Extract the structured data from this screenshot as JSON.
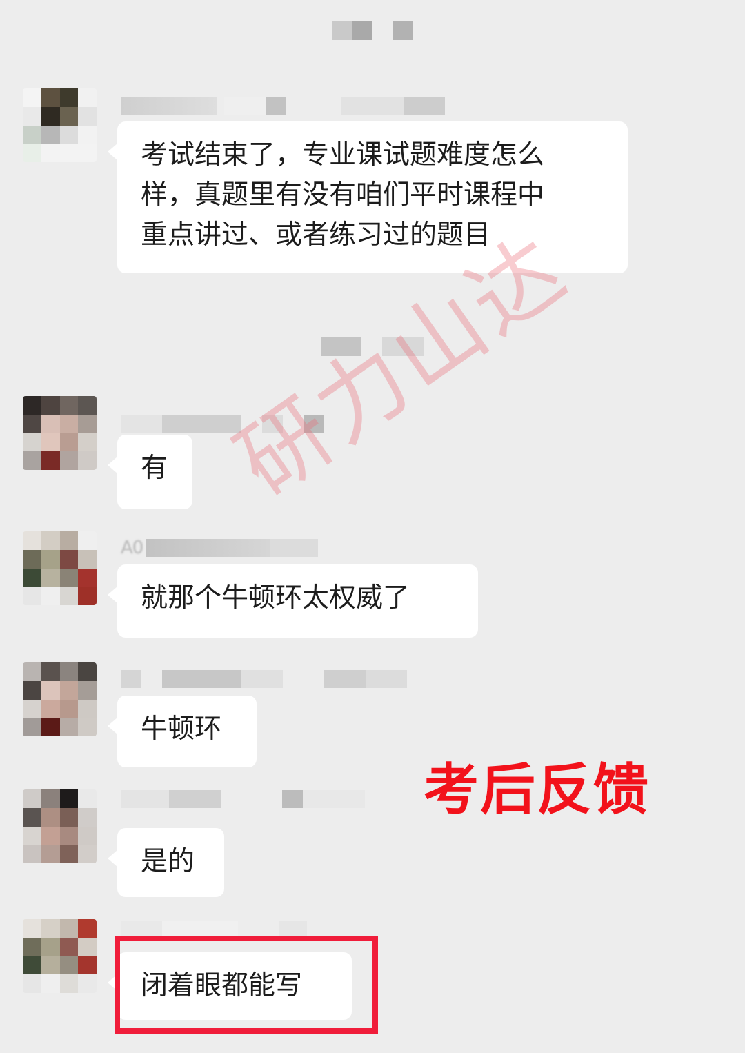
{
  "messages": [
    {
      "sender_visible": "",
      "text": "考试结束了，专业课试题难度怎么\n样，真题里有没有咱们平时课程中\n重点讲过、或者练习过的题目"
    },
    {
      "sender_visible": "",
      "text": "有"
    },
    {
      "sender_visible": "A0",
      "text": "就那个牛顿环太权威了"
    },
    {
      "sender_visible": "",
      "text": "牛顿环"
    },
    {
      "sender_visible": "",
      "text": "是的"
    },
    {
      "sender_visible": "",
      "text": "闭着眼都能写"
    }
  ],
  "watermark": "研力山达",
  "overlay_label": "考后反馈",
  "colors": {
    "background": "#ededed",
    "bubble": "#ffffff",
    "highlight": "#f01d3a",
    "label": "#f2121b",
    "watermark": "#ec6e78"
  }
}
